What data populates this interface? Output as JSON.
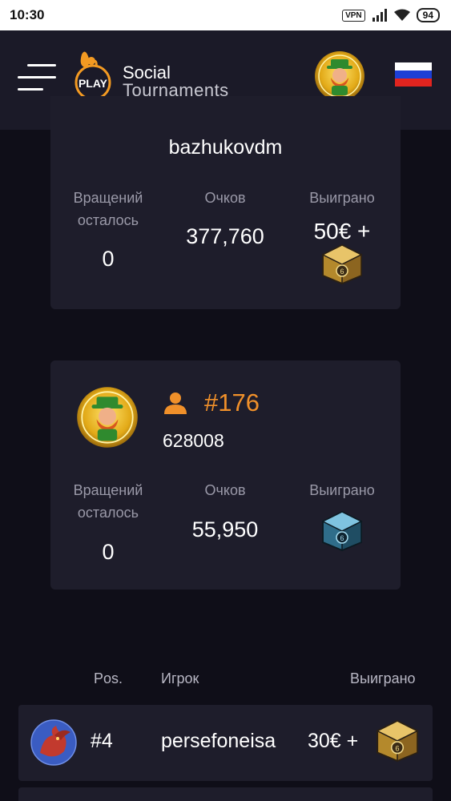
{
  "status_bar": {
    "time": "10:30",
    "vpn": "VPN",
    "battery": "94"
  },
  "header": {
    "brand_badge": "PLAY",
    "brand_line1": "Social",
    "brand_line2": "Tournaments",
    "flag_colors": [
      "#ffffff",
      "#1c3fd6",
      "#e1241f"
    ]
  },
  "top_card": {
    "username": "bazhukovdm",
    "spins_label_1": "Вращений",
    "spins_label_2": "осталось",
    "spins_value": "0",
    "points_label": "Очков",
    "points_value": "377,760",
    "won_label": "Выиграно",
    "won_value": "50€ +",
    "won_icon": "gold-cube-icon"
  },
  "user_card": {
    "rank": "#176",
    "player_id": "628008",
    "spins_label_1": "Вращений",
    "spins_label_2": "осталось",
    "spins_value": "0",
    "points_label": "Очков",
    "points_value": "55,950",
    "won_label": "Выиграно",
    "won_icon": "blue-cube-icon"
  },
  "leaderboard": {
    "columns": {
      "pos": "Pos.",
      "player": "Игрок",
      "won": "Выиграно"
    },
    "rows": [
      {
        "pos": "#4",
        "player": "persefoneisa",
        "won": "30€ +",
        "icon": "gold-cube-icon"
      }
    ]
  },
  "colors": {
    "background": "#0f0e18",
    "card": "#1e1d2b",
    "header": "#1b1a28",
    "accent_orange": "#f0902a",
    "muted_text": "#9a99a8"
  }
}
